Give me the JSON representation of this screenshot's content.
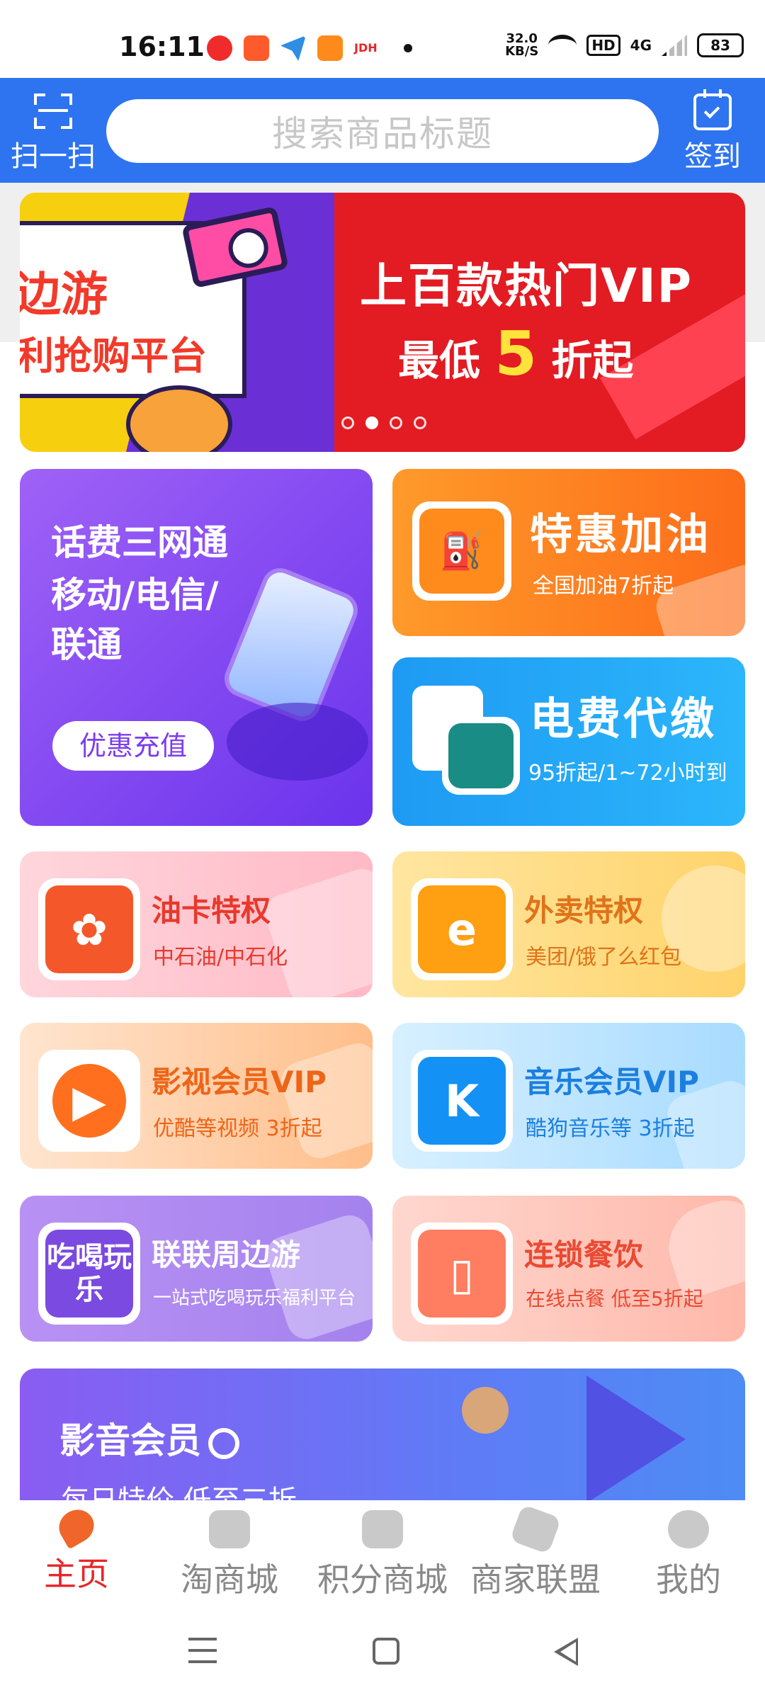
{
  "status_bar": {
    "time": "16:11",
    "net_speed_value": "32.0",
    "net_speed_unit": "KB/S",
    "hd_label": "HD",
    "network_label": "4G",
    "battery": "83"
  },
  "header": {
    "scan_label": "扫一扫",
    "search_placeholder": "搜索商品标题",
    "sign_label": "签到",
    "accent_color": "#2e74f1"
  },
  "banner": {
    "left_line1": "边游",
    "left_line2": "利抢购平台",
    "right_line1": "上百款热门VIP",
    "right_prefix": "最低",
    "right_number": "5",
    "right_suffix": "折起",
    "slide_count": 4,
    "active_slide": 2
  },
  "cards": {
    "phone": {
      "line1": "话费三网通",
      "line2": "移动/电信/",
      "line3": "联通",
      "button": "优惠充值"
    },
    "fuel": {
      "title": "特惠加油",
      "sub": "全国加油7折起"
    },
    "power": {
      "title": "电费代缴",
      "sub": "95折起/1~72小时到"
    },
    "oil": {
      "title": "油卡特权",
      "sub": "中石油/中石化"
    },
    "food": {
      "title": "外卖特权",
      "sub": "美团/饿了么红包"
    },
    "video": {
      "title": "影视会员VIP",
      "sub": "优酷等视频 3折起"
    },
    "music": {
      "title": "音乐会员VIP",
      "sub": "酷狗音乐等 3折起",
      "icon_letter": "K"
    },
    "tour": {
      "title": "联联周边游",
      "sub": "一站式吃喝玩乐福利平台",
      "icon_text": "吃喝玩乐"
    },
    "restaurant": {
      "title": "连锁餐饮",
      "sub": "在线点餐 低至5折起"
    },
    "media": {
      "title": "影音会员",
      "sub": "每日特价 低至三折"
    }
  },
  "bottom_nav": {
    "items": [
      {
        "label": "主页",
        "active": true
      },
      {
        "label": "淘商城",
        "active": false
      },
      {
        "label": "积分商城",
        "active": false
      },
      {
        "label": "商家联盟",
        "active": false
      },
      {
        "label": "我的",
        "active": false
      }
    ],
    "active_color": "#e8262a"
  }
}
